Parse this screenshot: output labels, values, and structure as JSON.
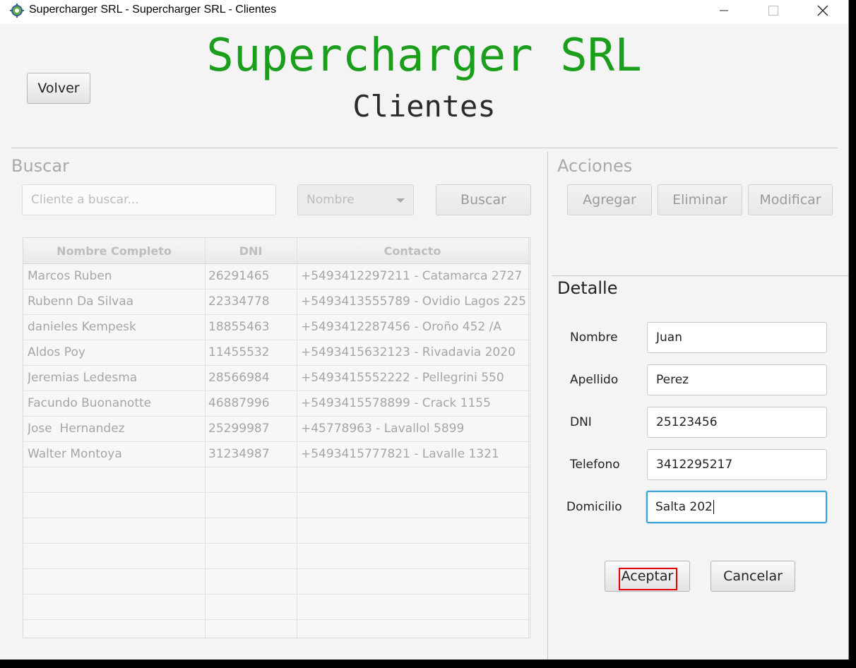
{
  "window": {
    "title": "Supercharger SRL - Supercharger SRL - Clientes"
  },
  "header": {
    "brand": "Supercharger SRL",
    "subtitle": "Clientes",
    "back_label": "Volver"
  },
  "search": {
    "title": "Buscar",
    "placeholder": "Cliente a buscar...",
    "filter_value": "Nombre",
    "button_label": "Buscar"
  },
  "table": {
    "columns": [
      "Nombre Completo",
      "DNI",
      "Contacto"
    ],
    "rows": [
      [
        "Marcos Ruben",
        "26291465",
        "+5493412297211 - Catamarca 2727"
      ],
      [
        "Rubenn Da Silvaa",
        "22334778",
        "+5493413555789 - Ovidio Lagos 225"
      ],
      [
        "danieles Kempesk",
        "18855463",
        "+5493412287456 - Oroño 452 /A"
      ],
      [
        "Aldos Poy",
        "11455532",
        "+5493415632123 - Rivadavia 2020"
      ],
      [
        "Jeremias Ledesma",
        "28566984",
        "+5493415552222 - Pellegrini 550"
      ],
      [
        "Facundo Buonanotte",
        "46887996",
        "+5493415578899 - Crack 1155"
      ],
      [
        "Jose  Hernandez",
        "25299987",
        "+45778963 - Lavallol 5899"
      ],
      [
        "Walter Montoya",
        "31234987",
        "+5493415777821 - Lavalle 1321"
      ]
    ]
  },
  "actions": {
    "title": "Acciones",
    "add_label": "Agregar",
    "delete_label": "Eliminar",
    "modify_label": "Modificar"
  },
  "detail": {
    "title": "Detalle",
    "fields": [
      {
        "label": "Nombre",
        "value": "Juan"
      },
      {
        "label": "Apellido",
        "value": "Perez"
      },
      {
        "label": "DNI",
        "value": "25123456"
      },
      {
        "label": "Telefono",
        "value": "3412295217"
      },
      {
        "label": "Domicilio",
        "value": "Salta 202"
      }
    ],
    "accept_label": "Aceptar",
    "cancel_label": "Cancelar"
  },
  "colors": {
    "brand": "#1b9e1b",
    "focus": "#3ea2d8",
    "highlight_box": "#e00000"
  }
}
